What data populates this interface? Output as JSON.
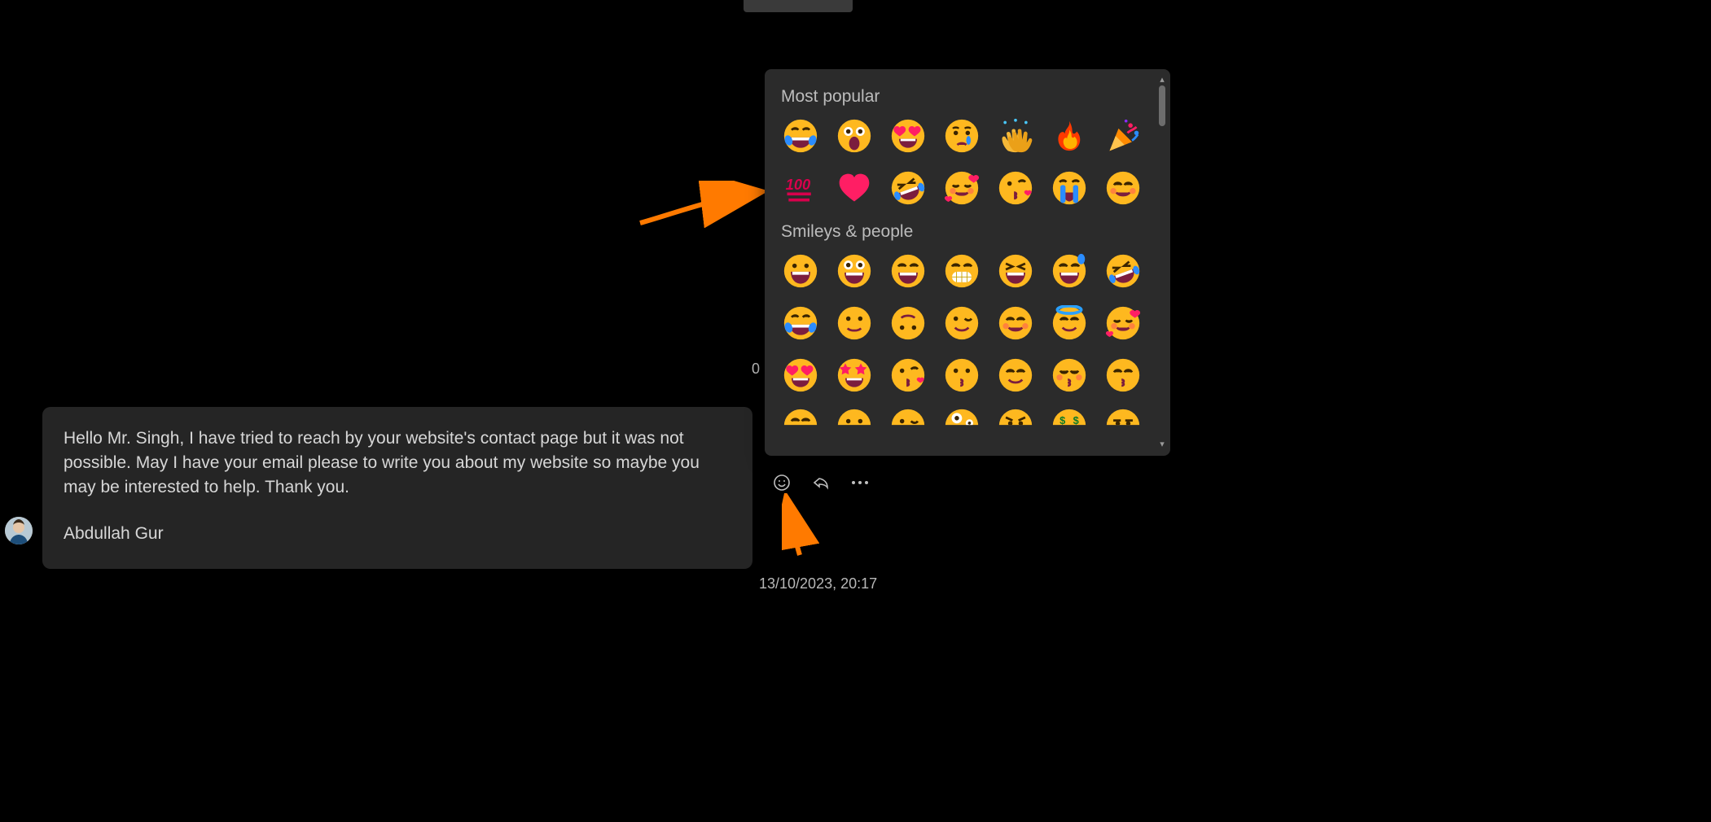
{
  "topbar": {
    "label": ""
  },
  "message": {
    "body": "Hello Mr. Singh, I have tried to reach by your website's contact page but it was not possible. May I have your email please to write you about my website so maybe you may be interested to help. Thank you.",
    "signature": "Abdullah Gur"
  },
  "zero": "0",
  "timestamp": "13/10/2023, 20:17",
  "actions": {
    "emoji_icon": "emoji-icon",
    "reply_icon": "reply-icon",
    "more_icon": "more-icon"
  },
  "picker": {
    "sections": {
      "most_popular": "Most popular",
      "smileys_people": "Smileys & people"
    },
    "most_popular": [
      [
        "face-with-tears-of-joy",
        "astonished-face",
        "smiling-face-with-heart-eyes",
        "crying-face",
        "clapping-hands",
        "fire",
        "party-popper"
      ],
      [
        "hundred-points",
        "red-heart",
        "rolling-on-the-floor-laughing",
        "smiling-face-with-hearts",
        "face-blowing-a-kiss",
        "loudly-crying-face",
        "smiling-face-with-smiling-eyes"
      ]
    ],
    "smileys_people": [
      [
        "grinning-face",
        "grinning-face-with-big-eyes",
        "grinning-face-with-smiling-eyes",
        "beaming-face-with-smiling-eyes",
        "grinning-squinting-face",
        "grinning-face-with-sweat",
        "rolling-on-the-floor-laughing"
      ],
      [
        "face-with-tears-of-joy",
        "slightly-smiling-face",
        "upside-down-face",
        "winking-face",
        "smiling-face-with-smiling-eyes",
        "smiling-face-with-halo",
        "smiling-face-with-hearts"
      ],
      [
        "smiling-face-with-heart-eyes",
        "star-struck",
        "face-blowing-a-kiss",
        "kissing-face",
        "smiling-face",
        "kissing-face-with-closed-eyes",
        "kissing-face-with-smiling-eyes"
      ],
      [
        "face-savoring-food",
        "face-with-tongue",
        "winking-face-with-tongue",
        "zany-face",
        "angry-face",
        "money-mouth-face",
        "unamused-face"
      ]
    ]
  }
}
